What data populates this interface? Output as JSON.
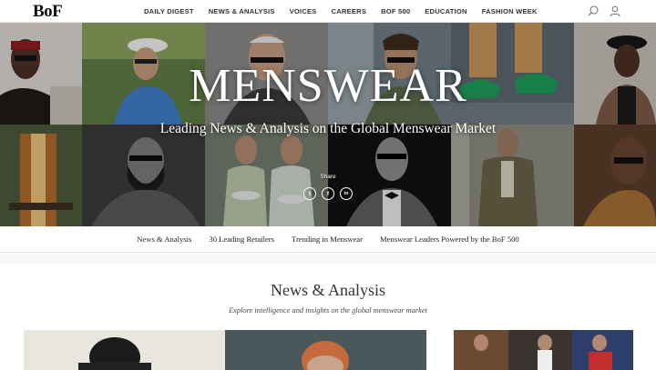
{
  "header": {
    "logo": "BoF",
    "nav": [
      "DAILY DIGEST",
      "NEWS & ANALYSIS",
      "VOICES",
      "CAREERS",
      "BOF 500",
      "EDUCATION",
      "FASHION WEEK"
    ],
    "icons": [
      "search-icon",
      "user-icon"
    ]
  },
  "hero": {
    "title": "MENSWEAR",
    "subtitle": "Leading News & Analysis on the Global Menswear Market",
    "share_label": "Share",
    "share_buttons": [
      {
        "icon": "twitter-icon",
        "glyph": "t"
      },
      {
        "icon": "facebook-icon",
        "glyph": "f"
      },
      {
        "icon": "linkedin-icon",
        "glyph": "in"
      }
    ]
  },
  "subnav": [
    "News & Analysis",
    "30 Leading Retailers",
    "Trending in Menswear",
    "Menswear Leaders Powered by the BoF 500"
  ],
  "section": {
    "title": "News & Analysis",
    "description": "Explore intelligence and insights on the global menswear market"
  },
  "colors": {
    "text": "#222222",
    "hero_overlay": "#000000",
    "divider": "#e0e0e0"
  }
}
